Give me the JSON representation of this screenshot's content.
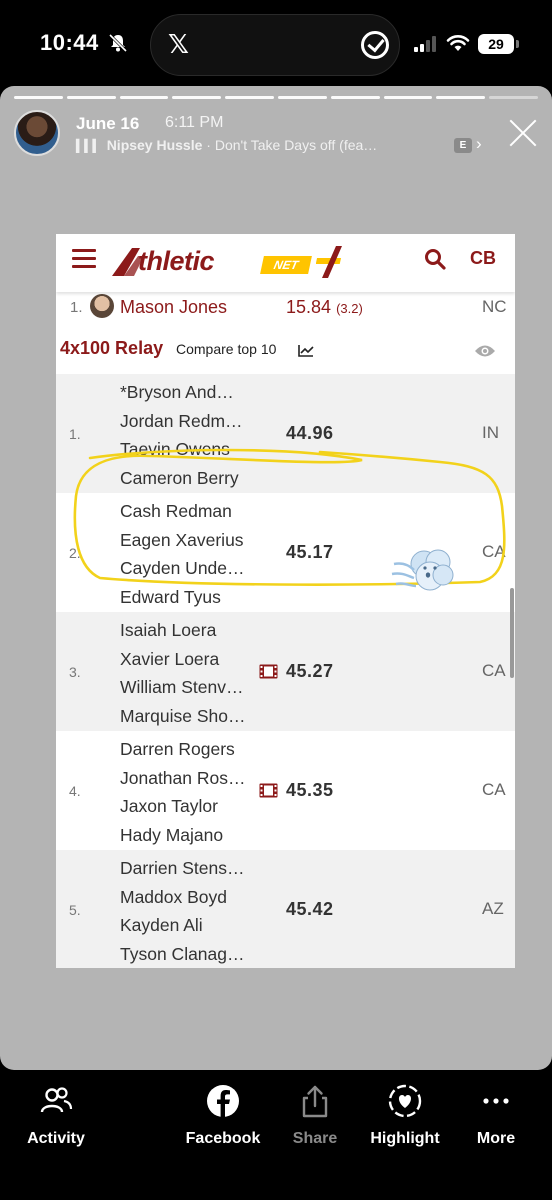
{
  "status_bar": {
    "time": "10:44",
    "battery": "29"
  },
  "story": {
    "date": "June 16",
    "time": "6:11 PM",
    "music_artist": "Nipsey Hussle",
    "music_track": " · Don't Take Days off (fea…",
    "explicit_badge": "E"
  },
  "athletic_net": {
    "logo_text": "thletic",
    "logo_net": "NET",
    "profile_initials": "CB",
    "top_result": {
      "rank": "1.",
      "name": "Mason Jones",
      "mark": "15.84",
      "wind": "(3.2)",
      "state": "NC"
    },
    "event": {
      "title": "4x100 Relay",
      "compare_label": "Compare top 10"
    },
    "results": [
      {
        "rank": "1.",
        "athletes": [
          "*Bryson And…",
          "Jordan Redm…",
          "Taevin Owens",
          "Cameron Berry"
        ],
        "time": "44.96",
        "state": "IN",
        "has_video": false
      },
      {
        "rank": "2.",
        "athletes": [
          "Cash Redman",
          "Eagen Xaverius",
          "Cayden Unde…",
          "Edward Tyus"
        ],
        "time": "45.17",
        "state": "CA",
        "has_video": false
      },
      {
        "rank": "3.",
        "athletes": [
          "Isaiah Loera",
          "Xavier Loera",
          "William Stenv…",
          "Marquise Sho…"
        ],
        "time": "45.27",
        "state": "CA",
        "has_video": true
      },
      {
        "rank": "4.",
        "athletes": [
          "Darren Rogers",
          "Jonathan Ros…",
          "Jaxon Taylor",
          "Hady Majano"
        ],
        "time": "45.35",
        "state": "CA",
        "has_video": true
      },
      {
        "rank": "5.",
        "athletes": [
          "Darrien Stens…",
          "Maddox Boyd",
          "Kayden Ali",
          "Tyson Clanag…"
        ],
        "time": "45.42",
        "state": "AZ",
        "has_video": false
      }
    ]
  },
  "bottom_bar": {
    "activity": "Activity",
    "facebook": "Facebook",
    "share": "Share",
    "highlight": "Highlight",
    "more": "More"
  },
  "colors": {
    "brand": "#8c1a1a",
    "accent": "#ffc400",
    "highlight_scribble": "#f2d21b",
    "story_background": "#b4b4b4"
  }
}
